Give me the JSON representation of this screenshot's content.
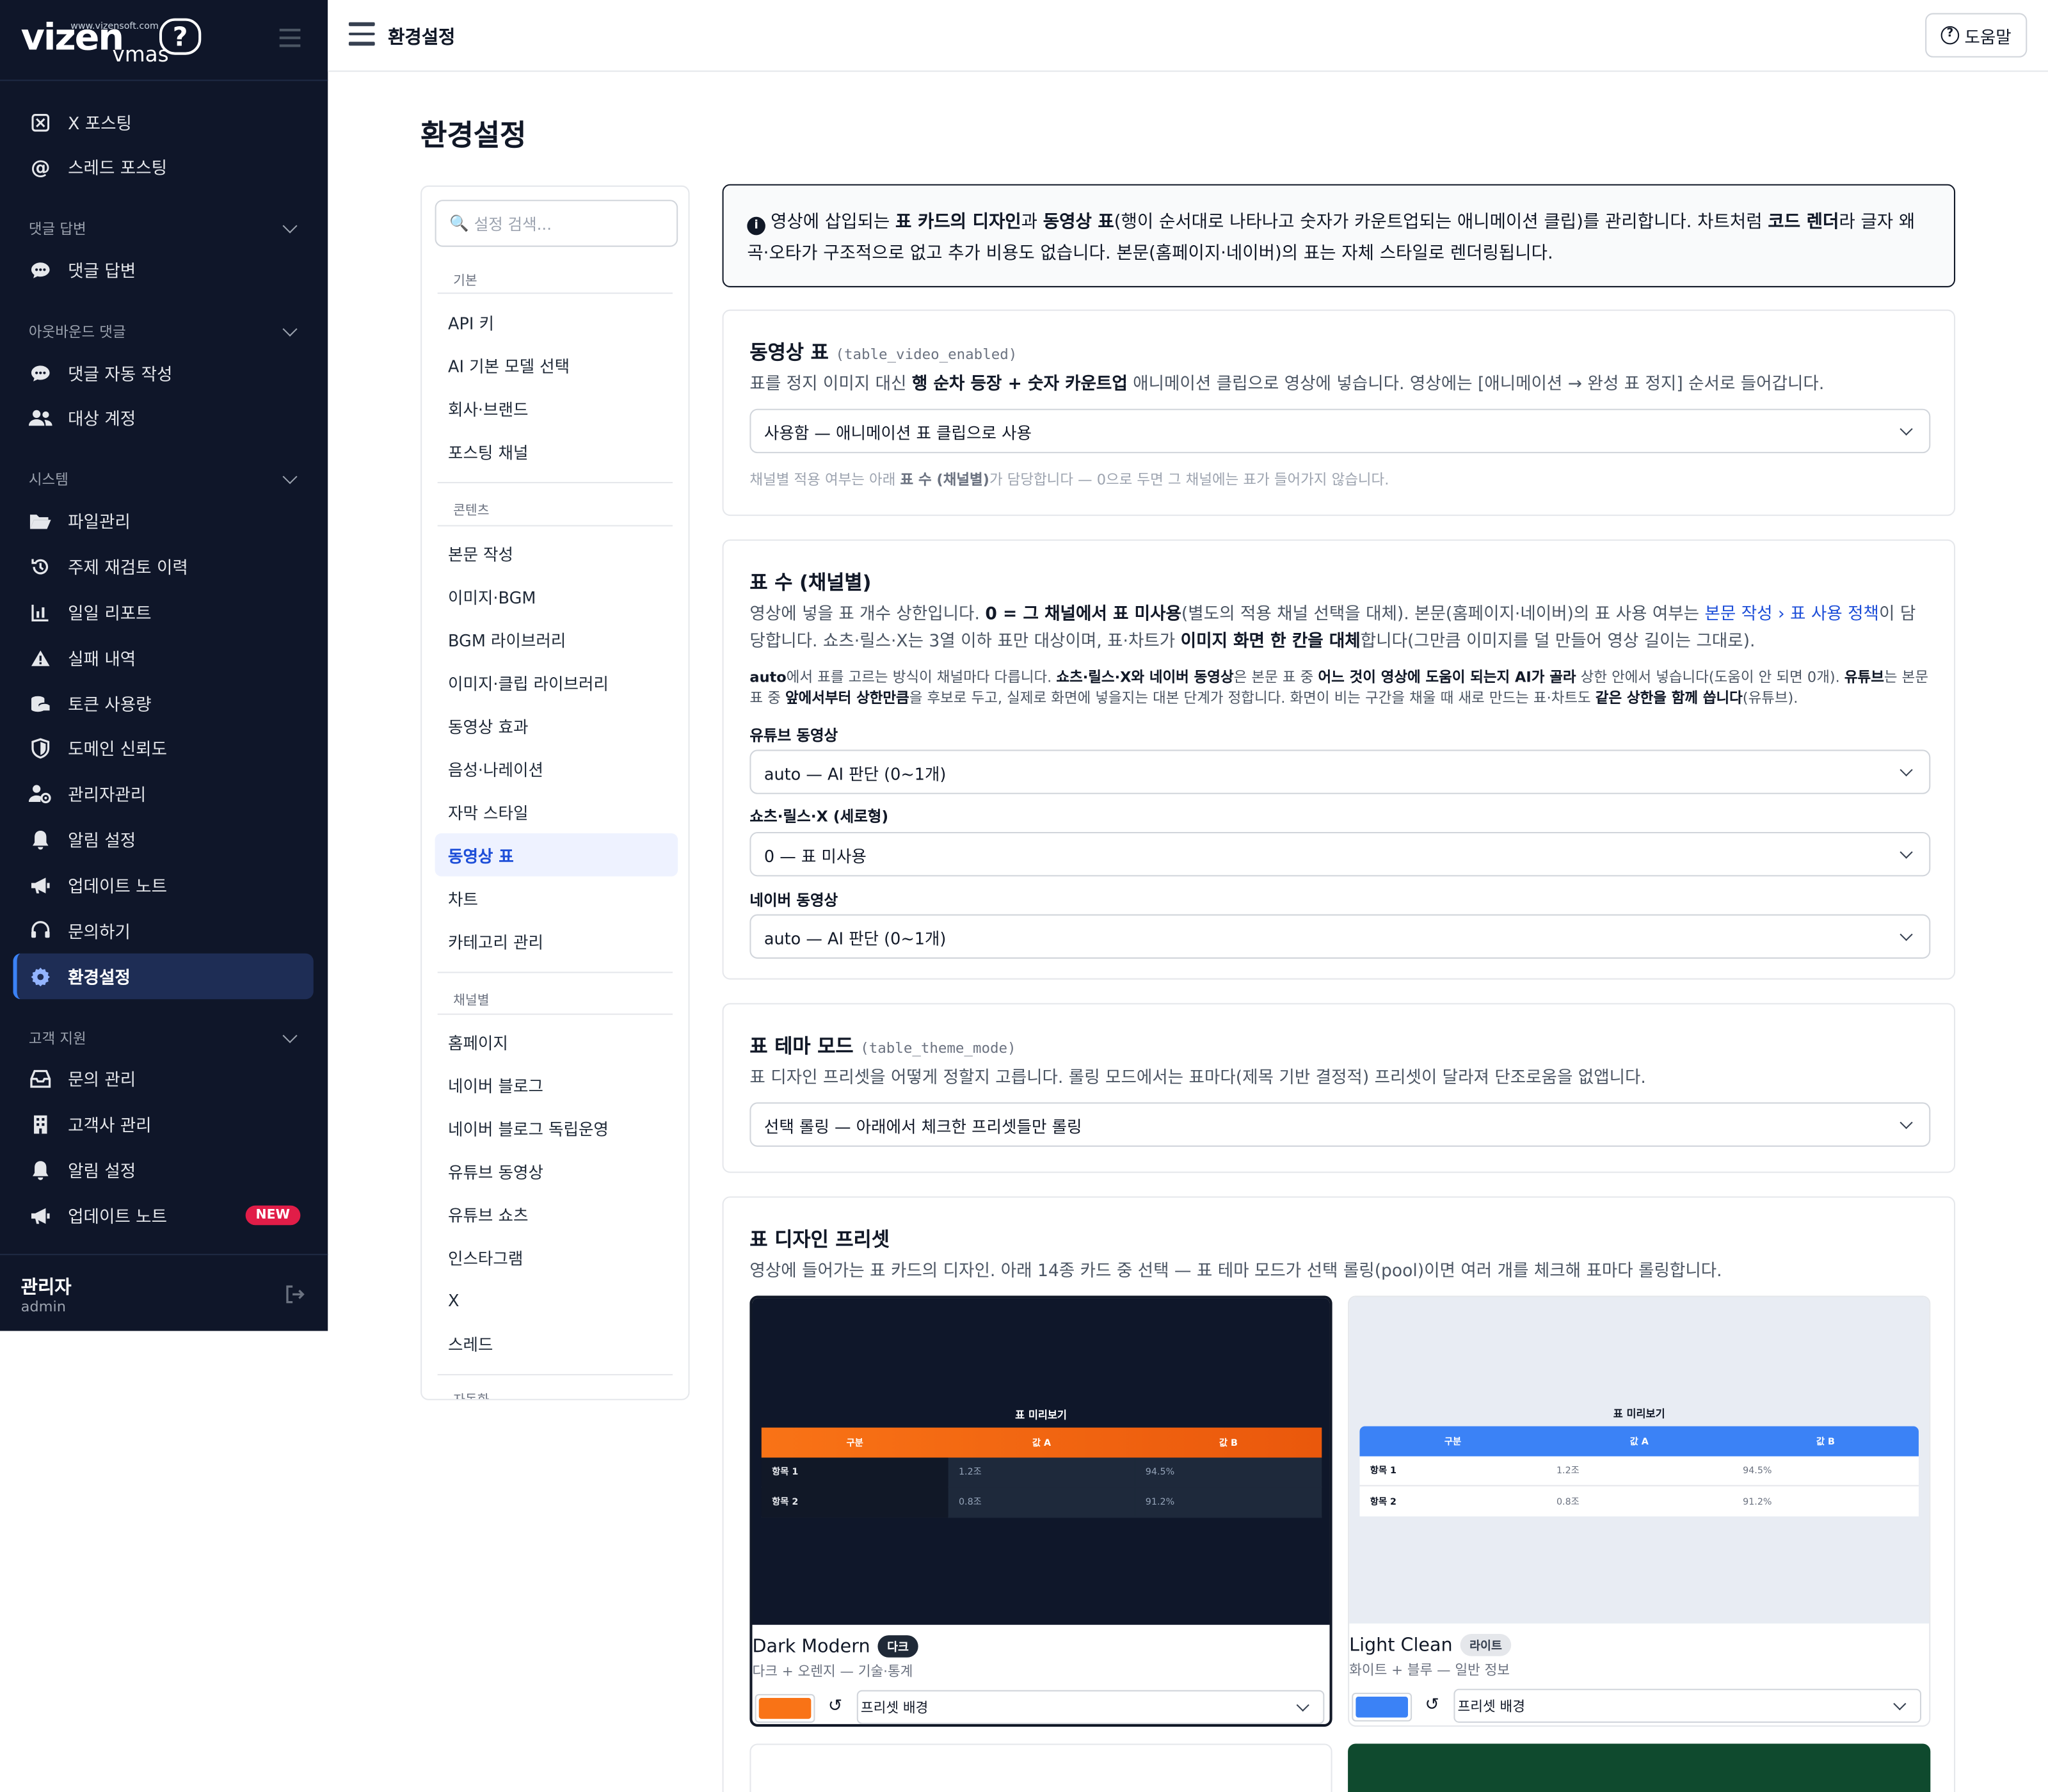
{
  "brand": {
    "main": "vizen",
    "sub": "vmas",
    "url": "www.vizensoft.com",
    "q": "?"
  },
  "sidebar": {
    "items_top": [
      {
        "label": "X 포스팅",
        "icon": "x-logo-icon"
      },
      {
        "label": "스레드 포스팅",
        "icon": "at-sign-icon"
      }
    ],
    "sections": [
      {
        "title": "댓글 답변",
        "items": [
          {
            "label": "댓글 답변",
            "icon": "chat-bubble-icon"
          }
        ]
      },
      {
        "title": "아웃바운드 댓글",
        "items": [
          {
            "label": "댓글 자동 작성",
            "icon": "chat-bubble-icon"
          },
          {
            "label": "대상 계정",
            "icon": "users-icon"
          }
        ]
      },
      {
        "title": "시스템",
        "items": [
          {
            "label": "파일관리",
            "icon": "folder-open-icon"
          },
          {
            "label": "주제 재검토 이력",
            "icon": "history-icon"
          },
          {
            "label": "일일 리포트",
            "icon": "bar-chart-icon"
          },
          {
            "label": "실패 내역",
            "icon": "warning-icon"
          },
          {
            "label": "토큰 사용량",
            "icon": "coins-icon"
          },
          {
            "label": "도메인 신뢰도",
            "icon": "shield-icon"
          },
          {
            "label": "관리자관리",
            "icon": "user-gear-icon"
          },
          {
            "label": "알림 설정",
            "icon": "bell-icon"
          },
          {
            "label": "업데이트 노트",
            "icon": "megaphone-icon"
          },
          {
            "label": "문의하기",
            "icon": "headset-icon"
          },
          {
            "label": "환경설정",
            "icon": "gear-icon"
          }
        ]
      },
      {
        "title": "고객 지원",
        "items": [
          {
            "label": "문의 관리",
            "icon": "inbox-icon"
          },
          {
            "label": "고객사 관리",
            "icon": "building-icon"
          },
          {
            "label": "알림 설정",
            "icon": "bell-icon"
          },
          {
            "label": "업데이트 노트",
            "icon": "megaphone-icon"
          }
        ]
      }
    ],
    "new_badge": "NEW",
    "user": {
      "name": "관리자",
      "id": "admin"
    }
  },
  "topbar": {
    "title": "환경설정",
    "help": "도움말"
  },
  "page": {
    "title": "환경설정"
  },
  "settings_nav": {
    "search_placeholder": "설정 검색...",
    "groups": [
      {
        "title": "기본",
        "items": [
          "API 키",
          "AI 기본 모델 선택",
          "회사·브랜드",
          "포스팅 채널"
        ]
      },
      {
        "title": "콘텐츠",
        "items": [
          "본문 작성",
          "이미지·BGM",
          "BGM 라이브러리",
          "이미지·클립 라이브러리",
          "동영상 효과",
          "음성·나레이션",
          "자막 스타일",
          "동영상 표",
          "차트",
          "카테고리 관리"
        ]
      },
      {
        "title": "채널별",
        "items": [
          "홈페이지",
          "네이버 블로그",
          "네이버 블로그 독립운영",
          "유튜브 동영상",
          "유튜브 쇼츠",
          "인스타그램",
          "X",
          "스레드"
        ]
      },
      {
        "title": "자동화",
        "items": []
      }
    ],
    "active": "동영상 표"
  },
  "info": {
    "p1": "영상에 삽입되는 ",
    "b1": "표 카드의 디자인",
    "p2": "과 ",
    "b2": "동영상 표",
    "p3": "(행이 순서대로 나타나고 숫자가 카운트업되는 애니메이션 클립)를 관리합니다. 차트처럼 ",
    "b3": "코드 렌더",
    "p4": "라 글자 왜곡·오타가 구조적으로 없고 추가 비용도 없습니다. 본문(홈페이지·네이버)의 표는 자체 스타일로 렌더링됩니다."
  },
  "card_video_table": {
    "title": "동영상 표",
    "key": "(table_video_enabled)",
    "desc_p1": "표를 정지 이미지 대신 ",
    "desc_b1": "행 순차 등장 + 숫자 카운트업",
    "desc_p2": " 애니메이션 클립으로 영상에 넣습니다. 영상에는 [애니메이션 → 완성 표 정지] 순서로 들어갑니다.",
    "select": "사용함 — 애니메이션 표 클립으로 사용",
    "note_p1": "채널별 적용 여부는 아래 ",
    "note_b1": "표 수 (채널별)",
    "note_p2": "가 담당합니다 — 0으로 두면 그 채널에는 표가 들어가지 않습니다."
  },
  "card_table_count": {
    "title": "표 수 (채널별)",
    "desc_p1": "영상에 넣을 표 개수 상한입니다. ",
    "desc_b1": "0 = 그 채널에서 표 미사용",
    "desc_p2": "(별도의 적용 채널 선택을 대체). 본문(홈페이지·네이버)의 표 사용 여부는 ",
    "desc_link": "본문 작성 › 표 사용 정책",
    "desc_p3": "이 담당합니다. 쇼츠·릴스·X는 3열 이하 표만 대상이며, 표·차트가 ",
    "desc_b2": "이미지 화면 한 칸을 대체",
    "desc_p4": "합니다(그만큼 이미지를 덜 만들어 영상 길이는 그대로).",
    "note_b1": "auto",
    "note_p1": "에서 표를 고르는 방식이 채널마다 다릅니다. ",
    "note_b2": "쇼츠·릴스·X와 네이버 동영상",
    "note_p2": "은 본문 표 중 ",
    "note_b3": "어느 것이 영상에 도움이 되는지 AI가 골라",
    "note_p3": " 상한 안에서 넣습니다(도움이 안 되면 0개). ",
    "note_b4": "유튜브",
    "note_p4": "는 본문 표 중 ",
    "note_b5": "앞에서부터 상한만큼",
    "note_p5": "을 후보로 두고, 실제로 화면에 넣을지는 대본 단계가 정합니다. 화면이 비는 구간을 채울 때 새로 만드는 표·차트도 ",
    "note_b6": "같은 상한을 함께 씁니다",
    "note_p6": "(유튜브).",
    "fields": [
      {
        "label": "유튜브 동영상",
        "value": "auto — AI 판단 (0~1개)"
      },
      {
        "label": "쇼츠·릴스·X (세로형)",
        "value": "0 — 표 미사용"
      },
      {
        "label": "네이버 동영상",
        "value": "auto — AI 판단 (0~1개)"
      }
    ]
  },
  "card_theme_mode": {
    "title": "표 테마 모드",
    "key": "(table_theme_mode)",
    "desc": "표 디자인 프리셋을 어떻게 정할지 고릅니다. 롤링 모드에서는 표마다(제목 기반 결정적) 프리셋이 달라져 단조로움을 없앱니다.",
    "select": "선택 롤링 — 아래에서 체크한 프리셋들만 롤링"
  },
  "card_presets": {
    "title": "표 디자인 프리셋",
    "desc": "영상에 들어가는 표 카드의 디자인. 아래 14종 카드 중 선택 — 표 테마 모드가 선택 롤링(pool)이면 여러 개를 체크해 표마다 롤링합니다.",
    "preview_title": "표 미리보기",
    "headers": [
      "구분",
      "값 A",
      "값 B"
    ],
    "rows": [
      [
        "항목 1",
        "1.2조",
        "94.5%"
      ],
      [
        "항목 2",
        "0.8조",
        "91.2%"
      ]
    ],
    "bg_select": "프리셋 배경",
    "items": [
      {
        "name": "Dark Modern",
        "tag": "다크",
        "sub": "다크 + 오렌지 — 기술·통계",
        "accent": "#f97316",
        "bg": "#0f172a"
      },
      {
        "name": "Light Clean",
        "tag": "라이트",
        "sub": "화이트 + 블루 — 일반 정보",
        "accent": "#3b82f6",
        "bg": "#e8ecf3"
      }
    ]
  },
  "colors": {
    "sidebar_bg": "#0f1629",
    "active_nav": "#1e2d55",
    "link": "#1d4ed8",
    "new_badge": "#e11d48"
  }
}
